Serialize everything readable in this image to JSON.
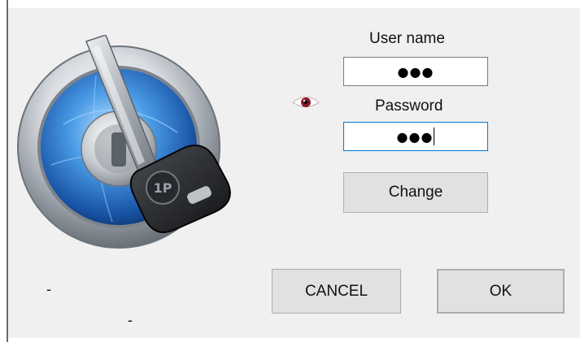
{
  "form": {
    "username_label": "User name",
    "username_value": "●●●",
    "password_label": "Password",
    "password_value": "●●●",
    "change_label": "Change"
  },
  "buttons": {
    "cancel_label": "CANCEL",
    "ok_label": "OK"
  },
  "status": {
    "left_text": "-",
    "bottom_text": "-"
  },
  "icons": {
    "logo": "1password-keyhole-key-logo",
    "reveal": "eye-icon"
  },
  "colors": {
    "dialog_bg": "#f0f0f0",
    "focus_border": "#0078d7"
  }
}
